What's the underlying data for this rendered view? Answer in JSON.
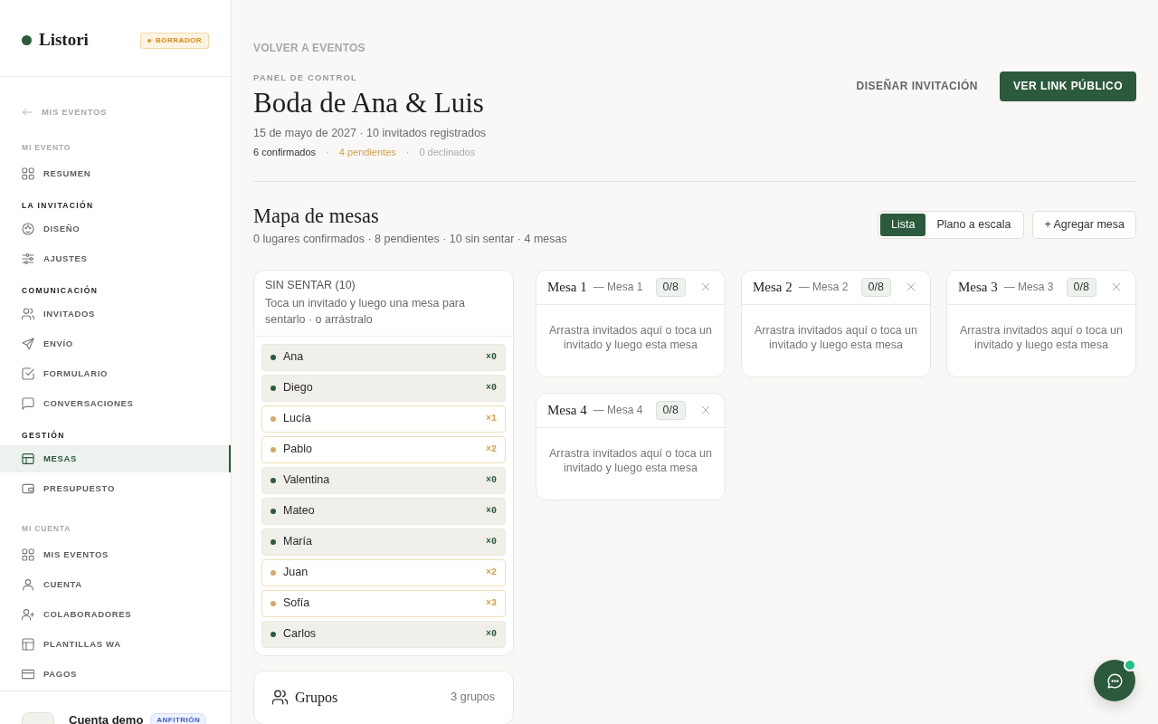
{
  "sidebar": {
    "logo": "Listori",
    "status": "BORRADOR",
    "back_link": "MIS EVENTOS",
    "sections": [
      {
        "title": "MI EVENTO",
        "muted": true,
        "items": [
          {
            "label": "RESUMEN",
            "selected": false
          }
        ]
      },
      {
        "title": "LA INVITACIÓN",
        "muted": false,
        "items": [
          {
            "label": "DISEÑO",
            "selected": false
          },
          {
            "label": "AJUSTES",
            "selected": false
          }
        ]
      },
      {
        "title": "COMUNICACIÓN",
        "muted": false,
        "items": [
          {
            "label": "INVITADOS",
            "selected": false
          },
          {
            "label": "ENVÍO",
            "selected": false
          },
          {
            "label": "FORMULARIO",
            "selected": false
          },
          {
            "label": "CONVERSACIONES",
            "selected": false
          }
        ]
      },
      {
        "title": "GESTIÓN",
        "muted": false,
        "items": [
          {
            "label": "MESAS",
            "selected": true
          },
          {
            "label": "PRESUPUESTO",
            "selected": false
          }
        ]
      },
      {
        "title": "MI CUENTA",
        "muted": true,
        "items": [
          {
            "label": "MIS EVENTOS",
            "selected": false
          },
          {
            "label": "CUENTA",
            "selected": false
          },
          {
            "label": "COLABORADORES",
            "selected": false
          },
          {
            "label": "PLANTILLAS WA",
            "selected": false
          },
          {
            "label": "PAGOS",
            "selected": false
          }
        ]
      }
    ],
    "account": {
      "name": "Cuenta demo",
      "role": "ANFITRIÓN"
    }
  },
  "header": {
    "back_link": "VOLVER A EVENTOS",
    "eyebrow": "PANEL DE CONTROL",
    "title": "Boda de Ana & Luis",
    "details": "15 de mayo de 2027 · 10 invitados registrados",
    "rsvp": [
      {
        "kind": "stat",
        "color": "#333333",
        "text": "6 confirmados"
      },
      {
        "kind": "separator",
        "text": "·"
      },
      {
        "kind": "stat",
        "color": "#d4a24c",
        "text": "4 pendientes"
      },
      {
        "kind": "separator",
        "text": "·"
      },
      {
        "kind": "stat",
        "color": "#aaaaaa",
        "text": "0 declinados"
      }
    ],
    "actions": [
      {
        "kind": "link",
        "label": "DISEÑAR INVITACIÓN"
      },
      {
        "kind": "primary",
        "label": "VER LINK PÚBLICO"
      }
    ]
  },
  "seating": {
    "title": "Mapa de mesas",
    "summary": "0 lugares confirmados · 8 pendientes · 10 sin sentar · 4 mesas",
    "views": [
      {
        "label": "Lista",
        "selected": true
      },
      {
        "label": "Plano a escala",
        "selected": false
      }
    ],
    "add_button": "+ Agregar mesa"
  },
  "unseated": {
    "title": "SIN SENTAR (10)",
    "hint": "Toca un invitado y luego una mesa para sentarlo · o arrástralo",
    "guests": [
      {
        "name": "Ana",
        "confirmed": true,
        "count": "×0"
      },
      {
        "name": "Diego",
        "confirmed": true,
        "count": "×0"
      },
      {
        "name": "Lucía",
        "confirmed": false,
        "count": "×1"
      },
      {
        "name": "Pablo",
        "confirmed": false,
        "count": "×2"
      },
      {
        "name": "Valentina",
        "confirmed": true,
        "count": "×0"
      },
      {
        "name": "Mateo",
        "confirmed": true,
        "count": "×0"
      },
      {
        "name": "María",
        "confirmed": true,
        "count": "×0"
      },
      {
        "name": "Juan",
        "confirmed": false,
        "count": "×2"
      },
      {
        "name": "Sofía",
        "confirmed": false,
        "count": "×3"
      },
      {
        "name": "Carlos",
        "confirmed": true,
        "count": "×0"
      }
    ]
  },
  "groups": {
    "title": "Grupos",
    "count": "3 grupos"
  },
  "tables": [
    {
      "name": "Mesa 1",
      "label": "— Mesa 1",
      "occupancy": "0/8",
      "hint": "Arrastra invitados aquí o toca un invitado y luego esta mesa"
    },
    {
      "name": "Mesa 2",
      "label": "— Mesa 2",
      "occupancy": "0/8",
      "hint": "Arrastra invitados aquí o toca un invitado y luego esta mesa"
    },
    {
      "name": "Mesa 3",
      "label": "— Mesa 3",
      "occupancy": "0/8",
      "hint": "Arrastra invitados aquí o toca un invitado y luego esta mesa"
    },
    {
      "name": "Mesa 4",
      "label": "— Mesa 4",
      "occupancy": "0/8",
      "hint": "Arrastra invitados aquí o toca un invitado y luego esta mesa"
    }
  ],
  "chat": {
    "unread": true
  }
}
